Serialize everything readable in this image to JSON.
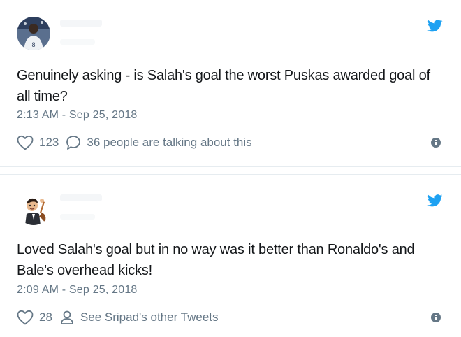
{
  "tweets": [
    {
      "text": "Genuinely asking - is Salah's goal the worst Puskas awarded goal of all time?",
      "timestamp": "2:13 AM - Sep 25, 2018",
      "like_count": "123",
      "secondary_action": "36 people are talking about this",
      "secondary_icon": "comment-icon"
    },
    {
      "text": "Loved Salah's goal but in no way was it better than Ronaldo's and Bale's overhead kicks!",
      "timestamp": "2:09 AM - Sep 25, 2018",
      "like_count": "28",
      "secondary_action": "See Sripad's other Tweets",
      "secondary_icon": "person-icon"
    }
  ],
  "colors": {
    "twitter_blue": "#1da1f2",
    "text": "#14171a",
    "muted": "#657786"
  }
}
